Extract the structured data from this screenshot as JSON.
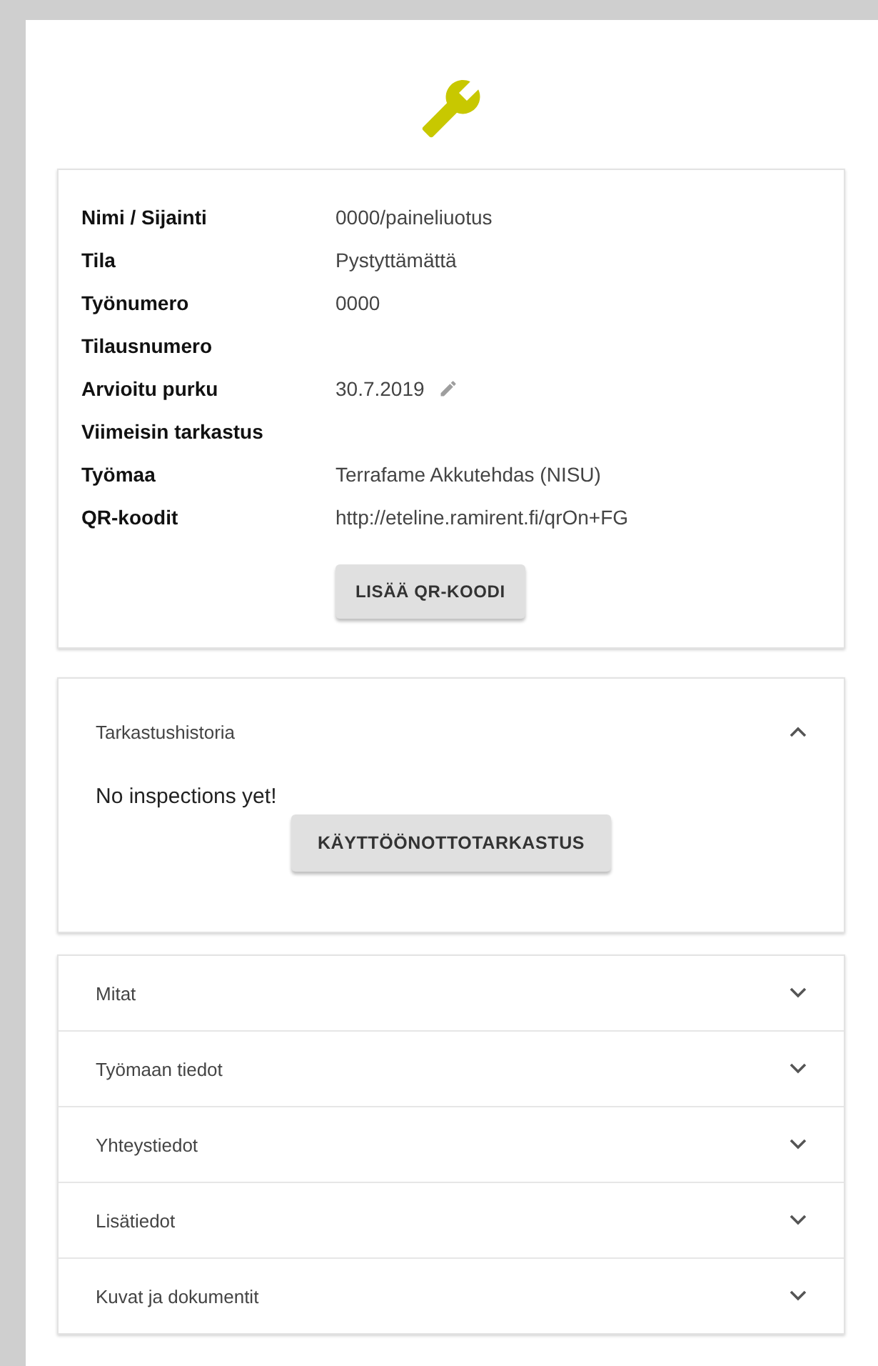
{
  "details": {
    "rows": [
      {
        "label": "Nimi / Sijainti",
        "value": "0000/paineliuotus",
        "editable": false
      },
      {
        "label": "Tila",
        "value": "Pystyttämättä",
        "editable": false
      },
      {
        "label": "Työnumero",
        "value": "0000",
        "editable": false
      },
      {
        "label": "Tilausnumero",
        "value": "",
        "editable": false
      },
      {
        "label": "Arvioitu purku",
        "value": "30.7.2019",
        "editable": true
      },
      {
        "label": "Viimeisin tarkastus",
        "value": "",
        "editable": false
      },
      {
        "label": "Työmaa",
        "value": "Terrafame Akkutehdas (NISU)",
        "editable": false
      },
      {
        "label": "QR-koodit",
        "value": "http://eteline.ramirent.fi/qrOn+FG",
        "editable": false
      }
    ],
    "button": "LISÄÄ QR-KOODI"
  },
  "history": {
    "title": "Tarkastushistoria",
    "expanded": true,
    "message": "No inspections yet!",
    "button": "KÄYTTÖÖNOTTOTARKASTUS"
  },
  "panels": [
    {
      "title": "Mitat",
      "expanded": false
    },
    {
      "title": "Työmaan tiedot",
      "expanded": false
    },
    {
      "title": "Yhteystiedot",
      "expanded": false
    },
    {
      "title": "Lisätiedot",
      "expanded": false
    },
    {
      "title": "Kuvat ja dokumentit",
      "expanded": false
    }
  ]
}
